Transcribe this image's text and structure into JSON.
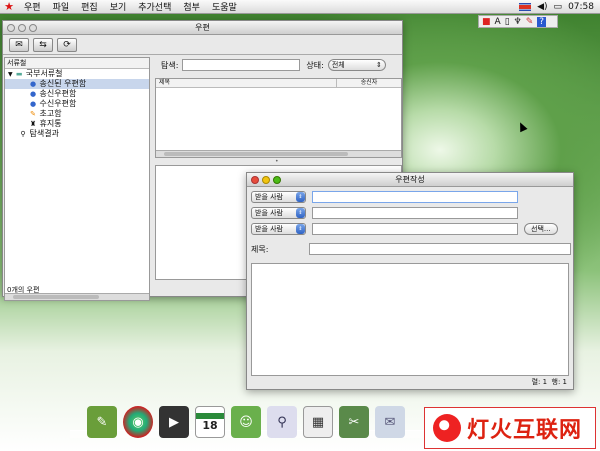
{
  "menubar": {
    "items": [
      "우편",
      "파일",
      "편집",
      "보기",
      "추가선택",
      "첨부",
      "도움말"
    ],
    "clock": "07:58"
  },
  "tray": {
    "letter": "A"
  },
  "mailbox": {
    "title": "우편",
    "sidebar_header": "서류철",
    "tree": [
      {
        "label": "국부서류철",
        "icon": "folder-icon",
        "level": 0,
        "prefix": "▼"
      },
      {
        "label": "송신된 우편함",
        "icon": "sent-icon",
        "level": 1,
        "selected": true
      },
      {
        "label": "송신우편함",
        "icon": "outbox-icon",
        "level": 1
      },
      {
        "label": "수신우편함",
        "icon": "inbox-icon",
        "level": 1
      },
      {
        "label": "초고함",
        "icon": "draft-icon",
        "level": 1
      },
      {
        "label": "휴지통",
        "icon": "trash-icon",
        "level": 1
      },
      {
        "label": "탐색결과",
        "icon": "search-icon",
        "level": 0
      }
    ],
    "status": "0개의 우편",
    "search_label": "탐색:",
    "search_value": "",
    "state_label": "상태:",
    "state_value": "전체",
    "columns": [
      "제목",
      "송신자"
    ]
  },
  "compose": {
    "title": "우편작성",
    "recipients": [
      {
        "label": "받을 사람",
        "value": ""
      },
      {
        "label": "받을 사람",
        "value": ""
      },
      {
        "label": "받을 사람",
        "value": ""
      }
    ],
    "select_button": "선택...",
    "subject_label": "제목:",
    "subject_value": "",
    "body": "",
    "position": "렬: 1  행: 1"
  },
  "dock": {
    "calendar_day": "18"
  },
  "watermark": "灯火互联网"
}
